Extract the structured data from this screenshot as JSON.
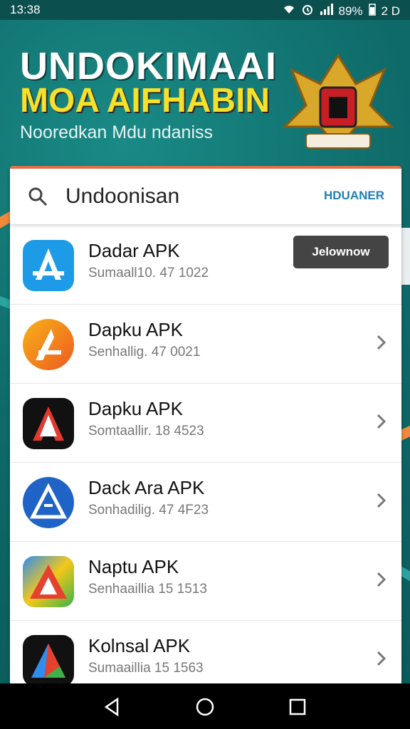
{
  "status": {
    "time": "13:38",
    "battery": "89%",
    "icons": [
      "wifi-icon",
      "alarm-icon",
      "signal-icon",
      "battery-icon"
    ],
    "extra": "2 D"
  },
  "banner": {
    "title_line1": "UNDOKIMAAI",
    "title_line2": "MOA AIFHABIN",
    "subtitle": "Nooredkan Mdu ndaniss"
  },
  "search": {
    "value": "Undoonisan",
    "action": "HDUANER"
  },
  "apps": [
    {
      "name": "Dadar APK",
      "meta": "Sumaall10. 47 1022",
      "action": "Jelownow",
      "icon": "blue-a-icon"
    },
    {
      "name": "Dapku APK",
      "meta": "Senhallig. 47 0021",
      "icon": "orange-a-icon"
    },
    {
      "name": "Dapku APK",
      "meta": "Somtaallir. 18 4523",
      "icon": "black-red-a-icon"
    },
    {
      "name": "Dack Ara APK",
      "meta": "Sonhadilig. 47 4F23",
      "icon": "blue-circle-a-icon"
    },
    {
      "name": "Naptu APK",
      "meta": "Senhaaillia 15 1513",
      "icon": "multicolor-a-icon"
    },
    {
      "name": "Kolnsal APK",
      "meta": "Sumaaillia 15 1563",
      "icon": "dark-multicolor-a-icon"
    }
  ],
  "colors": {
    "background": "#0f6b6b",
    "accent_yellow": "#f5e02a",
    "link_blue": "#1e7fb8"
  }
}
